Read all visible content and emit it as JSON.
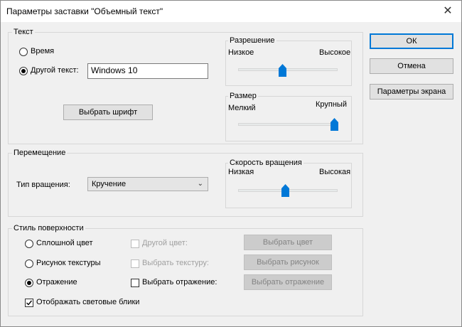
{
  "window": {
    "title": "Параметры заставки \"Объемный текст\"",
    "close_glyph": "✕"
  },
  "text_group": {
    "label": "Текст",
    "time_label": "Время",
    "other_text_label": "Другой текст:",
    "other_text_value": "Windows 10",
    "choose_font_label": "Выбрать шрифт",
    "selected": "other_text"
  },
  "resolution": {
    "label": "Разрешение",
    "low_label": "Низкое",
    "high_label": "Высокое",
    "level": 0.4
  },
  "size": {
    "label": "Размер",
    "small_label": "Мелкий",
    "large_label": "Крупный",
    "level": 1.0
  },
  "motion_group": {
    "label": "Перемещение",
    "rotation_type_label": "Тип вращения:",
    "rotation_type_value": "Кручение"
  },
  "speed": {
    "label": "Скорость вращения",
    "low_label": "Низкая",
    "high_label": "Высокая",
    "level": 0.4
  },
  "surface_group": {
    "label": "Стиль поверхности",
    "solid_color_label": "Сплошной цвет",
    "texture_label": "Рисунок текстуры",
    "reflection_label": "Отражение",
    "other_color_label": "Другой цвет:",
    "choose_texture_check_label": "Выбрать текстуру:",
    "choose_reflection_check_label": "Выбрать отражение:",
    "choose_color_btn": "Выбрать цвет",
    "choose_picture_btn": "Выбрать рисунок",
    "choose_reflection_btn": "Выбрать отражение",
    "highlights_label": "Отображать световые блики",
    "selected": "reflection",
    "highlights_checked": true
  },
  "buttons": {
    "ok": "ОК",
    "cancel": "Отмена",
    "screen_settings": "Параметры экрана"
  },
  "colors": {
    "accent": "#0078d7",
    "thumb": "#0078d7"
  }
}
